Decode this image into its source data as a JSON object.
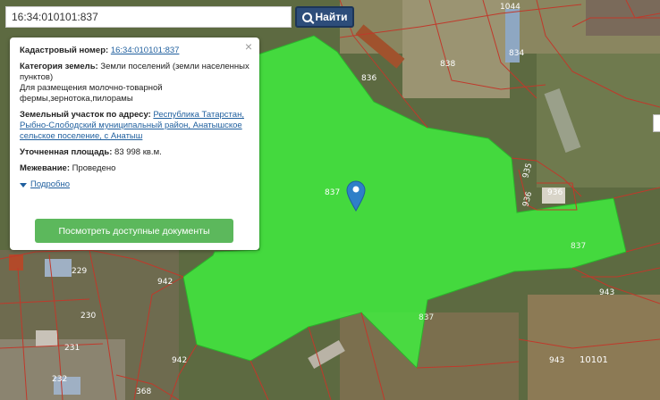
{
  "search": {
    "value": "16:34:010101:837",
    "button_label": "Найти"
  },
  "info": {
    "cadastral_label": "Кадастровый номер:",
    "cadastral_value": "16:34:010101:837",
    "category_label": "Категория земель:",
    "category_value": "Земли поселений (земли населенных пунктов)",
    "purpose": "Для размещения молочно-товарной фермы,зернотока,пилорамы",
    "address_label": "Земельный участок по адресу:",
    "address_value": "Республика Татарстан, Рыбно-Слободский муниципальный район, Анатышское сельское поселение, с Анатыш",
    "area_label": "Уточненная площадь:",
    "area_value": "83 998 кв.м.",
    "survey_label": "Межевание:",
    "survey_value": "Проведено",
    "more_label": "Подробно",
    "docs_button": "Посмотреть доступные документы",
    "close_symbol": "×"
  },
  "parcel_labels": {
    "p837a": "837",
    "p837b": "837",
    "p837c": "837",
    "p838": "838",
    "p836": "836",
    "p834": "834",
    "p1044": "1044",
    "p935": "935",
    "p936": "936",
    "p966": "936",
    "p943": "943",
    "p942": "942",
    "p942b": "942",
    "p943b": "943",
    "p229": "229",
    "p230": "230",
    "p231": "231",
    "p232": "232",
    "p368": "368",
    "p10101": "10101"
  },
  "colors": {
    "parcel_fill": "#3ef23e",
    "boundary": "#c0392b",
    "marker": "#2f7fc8",
    "search_button": "#2d4d7a",
    "docs_button": "#5cb85c"
  }
}
